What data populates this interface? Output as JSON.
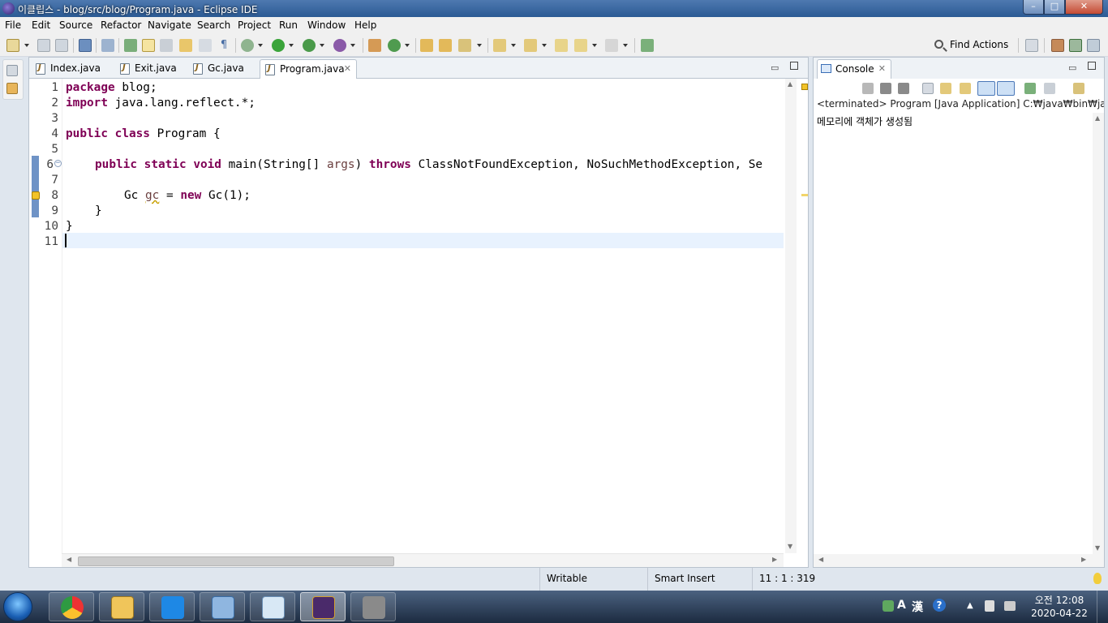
{
  "window": {
    "title": "이클립스 - blog/src/blog/Program.java - Eclipse IDE",
    "controls": [
      "–",
      "□",
      "✕"
    ]
  },
  "menu": [
    "File",
    "Edit",
    "Source",
    "Refactor",
    "Navigate",
    "Search",
    "Project",
    "Run",
    "Window",
    "Help"
  ],
  "toolbar": {
    "find_actions": "Find Actions"
  },
  "editor": {
    "tabs": [
      {
        "label": "Index.java",
        "active": false
      },
      {
        "label": "Exit.java",
        "active": false
      },
      {
        "label": "Gc.java",
        "active": false
      },
      {
        "label": "Program.java",
        "active": true
      }
    ],
    "close_glyph": "✕",
    "line_numbers": [
      "1",
      "2",
      "3",
      "4",
      "5",
      "6",
      "7",
      "8",
      "9",
      "10",
      "11"
    ],
    "code": {
      "l1_kw": "package",
      "l1_rest": " blog;",
      "l2_kw": "import",
      "l2_rest": " java.lang.reflect.*;",
      "l4_kw1": "public",
      "l4_kw2": "class",
      "l4_rest": " Program {",
      "l6_kw1": "public",
      "l6_kw2": "static",
      "l6_kw3": "void",
      "l6_mid": " main(String[] ",
      "l6_var": "args",
      "l6_mid2": ") ",
      "l6_kw4": "throws",
      "l6_rest": " ClassNotFoundException, NoSuchMethodException, Se",
      "l8_type": "Gc ",
      "l8_var": "gc",
      "l8_eq": " = ",
      "l8_kw": "new",
      "l8_rest": " Gc(1);",
      "l9": "}",
      "l10": "}"
    }
  },
  "console": {
    "tab_label": "Console",
    "status": "<terminated> Program [Java Application] C:₩java₩bin₩javaw.exe",
    "output": "메모리에 객체가 생성됨"
  },
  "statusbar": {
    "writable": "Writable",
    "insert_mode": "Smart Insert",
    "position": "11 : 1 : 319"
  },
  "taskbar": {
    "clock_time": "오전 12:08",
    "clock_date": "2020-04-22",
    "ime": "漢",
    "ime_letter": "A",
    "help_glyph": "?"
  },
  "colors": {
    "keyword": "#7f0055",
    "variable": "#6a3e3e",
    "current_line": "#e8f2fe"
  }
}
